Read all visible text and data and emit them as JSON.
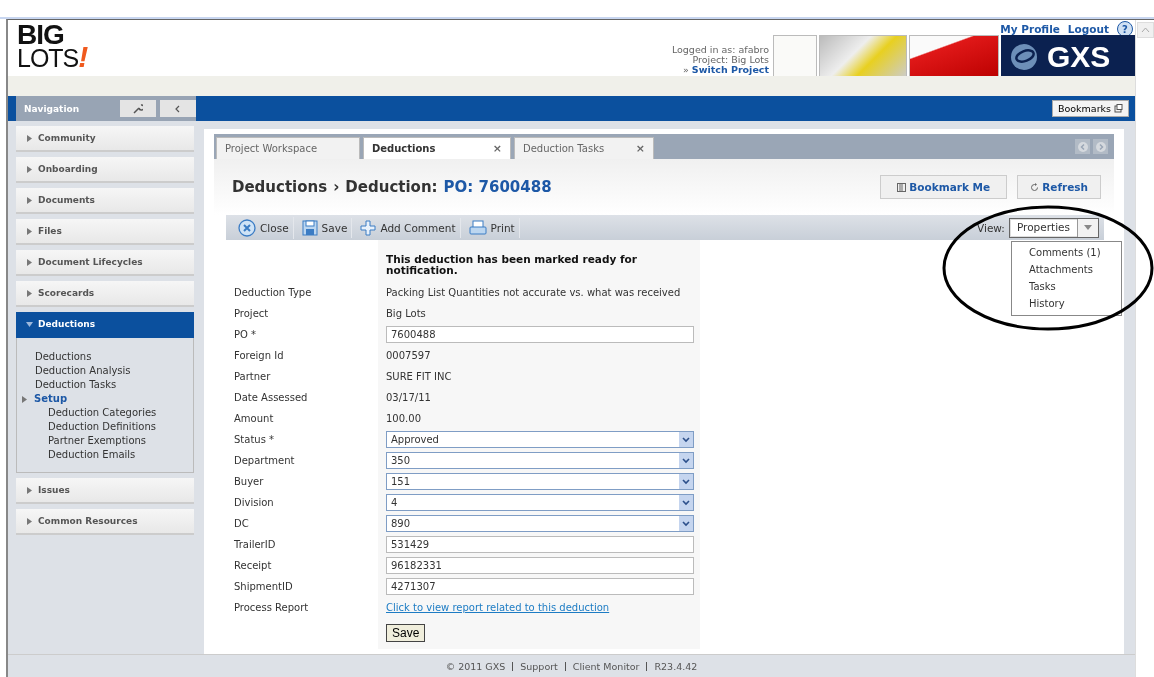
{
  "header": {
    "logo": {
      "line1": "BIG",
      "line2": "LOTS",
      "mark": "!"
    },
    "links": [
      "My Profile",
      "Logout"
    ],
    "help": "?",
    "login": [
      "Logged in as: afabro",
      "Project: Big Lots"
    ],
    "switch_project": {
      "arrow": "»",
      "label": "Switch Project"
    },
    "partner_logo": "GXS"
  },
  "nav": {
    "title": "Navigation",
    "bookmarks": "Bookmarks"
  },
  "sidebar": {
    "sections": [
      {
        "label": "Community",
        "expanded": false
      },
      {
        "label": "Onboarding",
        "expanded": false
      },
      {
        "label": "Documents",
        "expanded": false
      },
      {
        "label": "Files",
        "expanded": false
      },
      {
        "label": "Document Lifecycles",
        "expanded": false
      },
      {
        "label": "Scorecards",
        "expanded": false
      },
      {
        "label": "Deductions",
        "expanded": true,
        "items": [
          {
            "label": "Deductions"
          },
          {
            "label": "Deduction Analysis"
          },
          {
            "label": "Deduction Tasks"
          },
          {
            "label": "Setup",
            "children": [
              {
                "label": "Deduction Categories"
              },
              {
                "label": "Deduction Definitions"
              },
              {
                "label": "Partner Exemptions"
              },
              {
                "label": "Deduction Emails"
              }
            ]
          }
        ]
      },
      {
        "label": "Issues",
        "expanded": false
      },
      {
        "label": "Common Resources",
        "expanded": false
      }
    ]
  },
  "tabs": [
    {
      "label": "Project Workspace",
      "selected": false,
      "closable": false
    },
    {
      "label": "Deductions",
      "selected": true,
      "closable": true
    },
    {
      "label": "Deduction Tasks",
      "selected": false,
      "closable": true
    }
  ],
  "close_glyph": "×",
  "title": {
    "parent": "Deductions",
    "separator": "›",
    "current": "Deduction:",
    "record": "PO: 7600488"
  },
  "header_buttons": [
    {
      "label": "Bookmark Me",
      "kind": "bookmark"
    },
    {
      "label": "Refresh",
      "kind": "refresh"
    }
  ],
  "toolbar": [
    {
      "label": "Close",
      "kind": "close"
    },
    {
      "label": "Save",
      "kind": "save"
    },
    {
      "label": "Add Comment",
      "kind": "add"
    },
    {
      "label": "Print",
      "kind": "print"
    }
  ],
  "view": {
    "label": "View:",
    "value": "Properties",
    "expanded": true,
    "options": [
      "Comments (1)",
      "Attachments",
      "Tasks",
      "History"
    ]
  },
  "form": {
    "notice": "This deduction has been marked ready for notification.",
    "fields": [
      {
        "label": "Deduction Type",
        "kind": "text",
        "value": "Packing List Quantities not accurate vs. what was received"
      },
      {
        "label": "Project",
        "kind": "text",
        "value": "Big Lots"
      },
      {
        "label": "PO *",
        "kind": "input",
        "value": "7600488"
      },
      {
        "label": "Foreign Id",
        "kind": "text",
        "value": "0007597"
      },
      {
        "label": "Partner",
        "kind": "text",
        "value": "SURE FIT INC"
      },
      {
        "label": "Date Assessed",
        "kind": "text",
        "value": "03/17/11"
      },
      {
        "label": "Amount",
        "kind": "text",
        "value": "100.00"
      },
      {
        "label": "Status *",
        "kind": "select",
        "value": "Approved"
      },
      {
        "label": "Department",
        "kind": "select",
        "value": "350"
      },
      {
        "label": "Buyer",
        "kind": "select",
        "value": "151"
      },
      {
        "label": "Division",
        "kind": "select",
        "value": "4"
      },
      {
        "label": "DC",
        "kind": "select",
        "value": "890"
      },
      {
        "label": "TrailerID",
        "kind": "input",
        "value": "531429"
      },
      {
        "label": "Receipt",
        "kind": "input",
        "value": "96182331"
      },
      {
        "label": "ShipmentID",
        "kind": "input",
        "value": "4271307"
      },
      {
        "label": "Process Report",
        "kind": "link",
        "value": "Click to view report related to this deduction"
      }
    ],
    "submit": "Save"
  },
  "footer": [
    "© 2011 GXS",
    "Support",
    "Client Monitor",
    "R23.4.42"
  ]
}
